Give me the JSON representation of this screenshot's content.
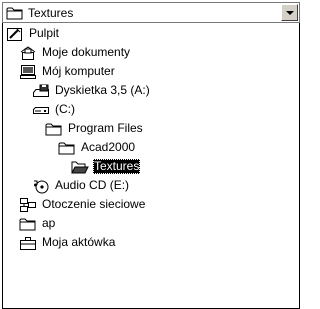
{
  "combo": {
    "value": "Textures",
    "selected_icon": "folder-icon"
  },
  "tree": [
    {
      "label": "Pulpit",
      "icon": "desktop-icon",
      "level": 0,
      "selected": false
    },
    {
      "label": "Moje dokumenty",
      "icon": "my-documents-icon",
      "level": 1,
      "selected": false
    },
    {
      "label": "Mój komputer",
      "icon": "my-computer-icon",
      "level": 1,
      "selected": false
    },
    {
      "label": "Dyskietka 3,5 (A:)",
      "icon": "floppy-drive-icon",
      "level": 2,
      "selected": false
    },
    {
      "label": "(C:)",
      "icon": "hard-drive-icon",
      "level": 2,
      "selected": false
    },
    {
      "label": "Program Files",
      "icon": "folder-icon",
      "level": 3,
      "selected": false
    },
    {
      "label": "Acad2000",
      "icon": "folder-icon",
      "level": 4,
      "selected": false
    },
    {
      "label": "Textures",
      "icon": "open-folder-icon",
      "level": 5,
      "selected": true
    },
    {
      "label": "Audio CD (E:)",
      "icon": "audio-cd-icon",
      "level": 2,
      "selected": false
    },
    {
      "label": "Otoczenie sieciowe",
      "icon": "network-neighborhood-icon",
      "level": 1,
      "selected": false
    },
    {
      "label": "ap",
      "icon": "folder-icon",
      "level": 1,
      "selected": false
    },
    {
      "label": "Moja aktówka",
      "icon": "briefcase-icon",
      "level": 1,
      "selected": false
    }
  ]
}
